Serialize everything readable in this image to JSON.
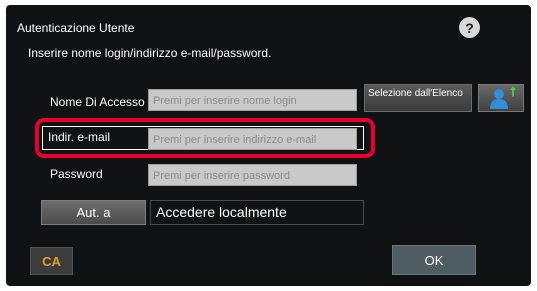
{
  "dialog": {
    "title": "Autenticazione Utente",
    "help_symbol": "?",
    "instruction": "Inserire nome login/indirizzo e-mail/password."
  },
  "fields": {
    "login": {
      "label": "Nome Di Accesso",
      "placeholder": "Premi per inserire nome login"
    },
    "email": {
      "label": "Indir. e-mail",
      "placeholder": "Premi per inserire indirizzo e-mail"
    },
    "password": {
      "label": "Password",
      "placeholder": "Premi per inserire password"
    }
  },
  "buttons": {
    "select_from_list": "Selezione dall'Elenco",
    "address_book_icon": "user-add-icon",
    "aut_a": "Aut. a",
    "ca": "CA",
    "ok": "OK"
  },
  "auth_target": "Accedere localmente",
  "colors": {
    "highlight": "#e6002d",
    "ca_text": "#e0a030",
    "address_icon": "#2f8fd8"
  }
}
